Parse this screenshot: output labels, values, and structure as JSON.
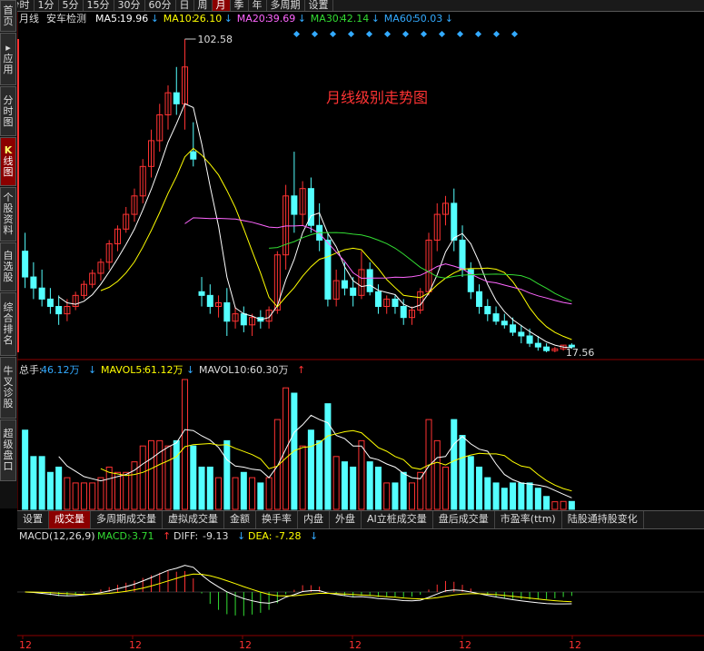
{
  "toolbar": {
    "items": [
      {
        "label": "分时",
        "icon": "back-arrow-icon",
        "active": false
      },
      {
        "label": "1分",
        "active": false
      },
      {
        "label": "5分",
        "active": false
      },
      {
        "label": "15分",
        "active": false
      },
      {
        "label": "30分",
        "active": false
      },
      {
        "label": "60分",
        "active": false
      },
      {
        "label": "日",
        "active": false
      },
      {
        "label": "周",
        "active": false
      },
      {
        "label": "月",
        "active": true
      },
      {
        "label": "季",
        "active": false
      },
      {
        "label": "年",
        "active": false
      },
      {
        "label": "多周期",
        "active": false
      },
      {
        "label": "设置",
        "active": false
      }
    ]
  },
  "sidebar": {
    "items": [
      {
        "label": "首页",
        "active": false
      },
      {
        "label": "应用",
        "icon": "arrow-right-icon",
        "active": false
      },
      {
        "label": "分时图",
        "active": false
      },
      {
        "label": "线图",
        "icon": "k-letter-icon",
        "prefix": "K",
        "active": true
      },
      {
        "label": "个股资料",
        "active": false
      },
      {
        "label": "自选股",
        "active": false
      },
      {
        "label": "综合排名",
        "active": false
      },
      {
        "label": "牛叉诊股",
        "active": false
      },
      {
        "label": "超级盘口",
        "active": false
      }
    ]
  },
  "price_panel": {
    "period": "月线",
    "indicator": "安车检测",
    "ma": [
      {
        "label": "MA5:",
        "value": "19.96",
        "arrow": "↓",
        "color": "#ffffff"
      },
      {
        "label": "MA10:",
        "value": "26.10",
        "arrow": "↓",
        "color": "#ffff00"
      },
      {
        "label": "MA20:",
        "value": "39.69",
        "arrow": "↓",
        "color": "#ff66ff"
      },
      {
        "label": "MA30:",
        "value": "42.14",
        "arrow": "↓",
        "color": "#33dd33"
      },
      {
        "label": "MA60:",
        "value": "50.03",
        "arrow": "↓",
        "color": "#33aaff"
      }
    ],
    "title": "月线级别走势图",
    "high_label": "102.58",
    "low_label": "17.56"
  },
  "volume_panel": {
    "total_label": "总手:",
    "total_value": "46.12万",
    "total_arrow": "↓",
    "mavol5_label": "MAVOL5:",
    "mavol5_value": "61.12万",
    "mavol5_arrow": "↓",
    "mavol10_label": "MAVOL10:",
    "mavol10_value": "60.30万",
    "mavol10_arrow": "↑"
  },
  "tabs": {
    "items": [
      {
        "label": "设置",
        "active": false
      },
      {
        "label": "成交量",
        "active": true
      },
      {
        "label": "多周期成交量",
        "active": false
      },
      {
        "label": "虚拟成交量",
        "active": false
      },
      {
        "label": "金额",
        "active": false
      },
      {
        "label": "换手率",
        "active": false
      },
      {
        "label": "内盘",
        "active": false
      },
      {
        "label": "外盘",
        "active": false
      },
      {
        "label": "AI立桩成交量",
        "active": false
      },
      {
        "label": "盘后成交量",
        "active": false
      },
      {
        "label": "市盈率(ttm)",
        "active": false
      },
      {
        "label": "陆股通持股变化",
        "active": false
      }
    ]
  },
  "macd_panel": {
    "name": "MACD(12,26,9)",
    "macd_label": "MACD:",
    "macd_value": "-3.71",
    "macd_arrow": "↑",
    "diff_label": "DIFF:",
    "diff_value": "-9.13",
    "diff_arrow": "↓",
    "dea_label": "DEA:",
    "dea_value": "-7.28",
    "dea_arrow": "↓"
  },
  "x_axis_labels": [
    "12",
    "12",
    "12",
    "12",
    "12",
    "12"
  ],
  "colors": {
    "up": "#ff3333",
    "down": "#54ffff",
    "bg": "#000000",
    "grid": "#8b0000"
  },
  "chart_data": {
    "type": "candlestick",
    "price_range": [
      17.56,
      102.58
    ],
    "candles": [
      {
        "o": 45,
        "h": 50,
        "l": 35,
        "c": 38
      },
      {
        "o": 38,
        "h": 42,
        "l": 32,
        "c": 35
      },
      {
        "o": 35,
        "h": 40,
        "l": 30,
        "c": 32
      },
      {
        "o": 32,
        "h": 35,
        "l": 28,
        "c": 30
      },
      {
        "o": 30,
        "h": 33,
        "l": 25,
        "c": 28
      },
      {
        "o": 28,
        "h": 32,
        "l": 26,
        "c": 30
      },
      {
        "o": 30,
        "h": 34,
        "l": 29,
        "c": 33
      },
      {
        "o": 33,
        "h": 37,
        "l": 32,
        "c": 36
      },
      {
        "o": 36,
        "h": 40,
        "l": 35,
        "c": 39
      },
      {
        "o": 39,
        "h": 43,
        "l": 37,
        "c": 42
      },
      {
        "o": 42,
        "h": 48,
        "l": 40,
        "c": 47
      },
      {
        "o": 47,
        "h": 52,
        "l": 45,
        "c": 51
      },
      {
        "o": 51,
        "h": 57,
        "l": 50,
        "c": 55
      },
      {
        "o": 55,
        "h": 62,
        "l": 53,
        "c": 60
      },
      {
        "o": 60,
        "h": 70,
        "l": 58,
        "c": 68
      },
      {
        "o": 68,
        "h": 78,
        "l": 65,
        "c": 75
      },
      {
        "o": 75,
        "h": 85,
        "l": 72,
        "c": 82
      },
      {
        "o": 82,
        "h": 90,
        "l": 78,
        "c": 88
      },
      {
        "o": 88,
        "h": 95,
        "l": 82,
        "c": 85
      },
      {
        "o": 85,
        "h": 102.58,
        "l": 78,
        "c": 95
      },
      {
        "o": 72,
        "h": 80,
        "l": 68,
        "c": 70
      },
      {
        "o": 34,
        "h": 38,
        "l": 30,
        "c": 33
      },
      {
        "o": 33,
        "h": 36,
        "l": 28,
        "c": 30
      },
      {
        "o": 30,
        "h": 33,
        "l": 27,
        "c": 31
      },
      {
        "o": 31,
        "h": 35,
        "l": 22,
        "c": 26
      },
      {
        "o": 26,
        "h": 30,
        "l": 24,
        "c": 28
      },
      {
        "o": 28,
        "h": 30,
        "l": 23,
        "c": 25
      },
      {
        "o": 25,
        "h": 28,
        "l": 22,
        "c": 27
      },
      {
        "o": 27,
        "h": 29,
        "l": 24,
        "c": 26
      },
      {
        "o": 26,
        "h": 30,
        "l": 24,
        "c": 29
      },
      {
        "o": 29,
        "h": 45,
        "l": 28,
        "c": 44
      },
      {
        "o": 44,
        "h": 63,
        "l": 40,
        "c": 60
      },
      {
        "o": 60,
        "h": 72,
        "l": 50,
        "c": 55
      },
      {
        "o": 55,
        "h": 64,
        "l": 52,
        "c": 62
      },
      {
        "o": 62,
        "h": 65,
        "l": 50,
        "c": 52
      },
      {
        "o": 52,
        "h": 58,
        "l": 45,
        "c": 48
      },
      {
        "o": 48,
        "h": 50,
        "l": 30,
        "c": 32
      },
      {
        "o": 32,
        "h": 40,
        "l": 30,
        "c": 37
      },
      {
        "o": 37,
        "h": 42,
        "l": 33,
        "c": 35
      },
      {
        "o": 35,
        "h": 38,
        "l": 30,
        "c": 33
      },
      {
        "o": 33,
        "h": 45,
        "l": 32,
        "c": 40
      },
      {
        "o": 40,
        "h": 42,
        "l": 33,
        "c": 34
      },
      {
        "o": 34,
        "h": 36,
        "l": 28,
        "c": 30
      },
      {
        "o": 30,
        "h": 33,
        "l": 28,
        "c": 32
      },
      {
        "o": 32,
        "h": 33,
        "l": 28,
        "c": 30
      },
      {
        "o": 30,
        "h": 32,
        "l": 25,
        "c": 27
      },
      {
        "o": 27,
        "h": 30,
        "l": 25,
        "c": 29
      },
      {
        "o": 29,
        "h": 35,
        "l": 28,
        "c": 34
      },
      {
        "o": 34,
        "h": 50,
        "l": 33,
        "c": 48
      },
      {
        "o": 48,
        "h": 58,
        "l": 45,
        "c": 55
      },
      {
        "o": 55,
        "h": 60,
        "l": 52,
        "c": 58
      },
      {
        "o": 58,
        "h": 62,
        "l": 45,
        "c": 48
      },
      {
        "o": 48,
        "h": 52,
        "l": 38,
        "c": 40
      },
      {
        "o": 40,
        "h": 42,
        "l": 32,
        "c": 34
      },
      {
        "o": 34,
        "h": 36,
        "l": 28,
        "c": 30
      },
      {
        "o": 30,
        "h": 32,
        "l": 26,
        "c": 28
      },
      {
        "o": 28,
        "h": 30,
        "l": 25,
        "c": 26
      },
      {
        "o": 26,
        "h": 28,
        "l": 24,
        "c": 25
      },
      {
        "o": 25,
        "h": 27,
        "l": 22,
        "c": 23
      },
      {
        "o": 23,
        "h": 25,
        "l": 20,
        "c": 22
      },
      {
        "o": 22,
        "h": 24,
        "l": 19,
        "c": 20
      },
      {
        "o": 20,
        "h": 22,
        "l": 18,
        "c": 19
      },
      {
        "o": 19,
        "h": 20,
        "l": 17.56,
        "c": 18
      },
      {
        "o": 18,
        "h": 19,
        "l": 17.56,
        "c": 18.5
      },
      {
        "o": 18.5,
        "h": 19.5,
        "l": 18,
        "c": 19.5
      },
      {
        "o": 19.5,
        "h": 20,
        "l": 18.5,
        "c": 19
      }
    ]
  }
}
